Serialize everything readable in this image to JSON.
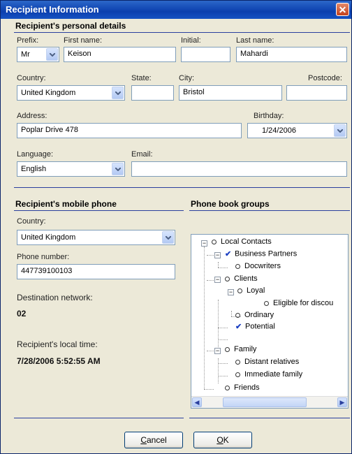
{
  "window": {
    "title": "Recipient Information",
    "close_glyph": "✕"
  },
  "personal": {
    "section_title": "Recipient's personal details",
    "prefix": {
      "label": "Prefix:",
      "value": "Mr"
    },
    "first_name": {
      "label": "First name:",
      "value": "Keison"
    },
    "initial": {
      "label": "Initial:",
      "value": ""
    },
    "last_name": {
      "label": "Last name:",
      "value": "Mahardi"
    },
    "country": {
      "label": "Country:",
      "value": "United Kingdom"
    },
    "state": {
      "label": "State:",
      "value": ""
    },
    "city": {
      "label": "City:",
      "value": "Bristol"
    },
    "postcode": {
      "label": "Postcode:",
      "value": ""
    },
    "address": {
      "label": "Address:",
      "value": "Poplar Drive 478"
    },
    "birthday": {
      "label": "Birthday:",
      "value": "1/24/2006"
    },
    "language": {
      "label": "Language:",
      "value": "English"
    },
    "email": {
      "label": "Email:",
      "value": ""
    }
  },
  "mobile": {
    "section_title": "Recipient's mobile phone",
    "country": {
      "label": "Country:",
      "value": "United Kingdom"
    },
    "phone": {
      "label": "Phone number:",
      "value": "447739100103"
    },
    "network": {
      "label": "Destination network:",
      "value": "02"
    },
    "local_time": {
      "label": "Recipient's local time:",
      "value": "7/28/2006 5:52:55 AM"
    }
  },
  "groups": {
    "section_title": "Phone book groups",
    "tree": [
      {
        "label": "Local Contacts",
        "state": "unchecked",
        "expander": "minus"
      },
      {
        "label": "Business Partners",
        "state": "checked",
        "expander": "minus"
      },
      {
        "label": "Docwriters",
        "state": "unchecked",
        "expander": ""
      },
      {
        "label": "Clients",
        "state": "unchecked",
        "expander": "minus"
      },
      {
        "label": "Loyal",
        "state": "unchecked",
        "expander": "minus"
      },
      {
        "label": "Eligible for discou",
        "state": "unchecked",
        "expander": ""
      },
      {
        "label": "Ordinary",
        "state": "unchecked",
        "expander": ""
      },
      {
        "label": "Potential",
        "state": "checked",
        "expander": ""
      },
      {
        "label": "Family",
        "state": "unchecked",
        "expander": "minus"
      },
      {
        "label": "Distant relatives",
        "state": "unchecked",
        "expander": ""
      },
      {
        "label": "Immediate family",
        "state": "unchecked",
        "expander": ""
      },
      {
        "label": "Friends",
        "state": "unchecked",
        "expander": ""
      }
    ]
  },
  "buttons": {
    "cancel": "Cancel",
    "cancel_key": "C",
    "cancel_rest": "ancel",
    "ok": "OK",
    "ok_key": "O",
    "ok_rest": "K"
  },
  "colors": {
    "accent": "#2a3f9e",
    "title_bar": "#0b3fae",
    "dialog_bg": "#ece9d8",
    "check": "#1b3fc2"
  }
}
